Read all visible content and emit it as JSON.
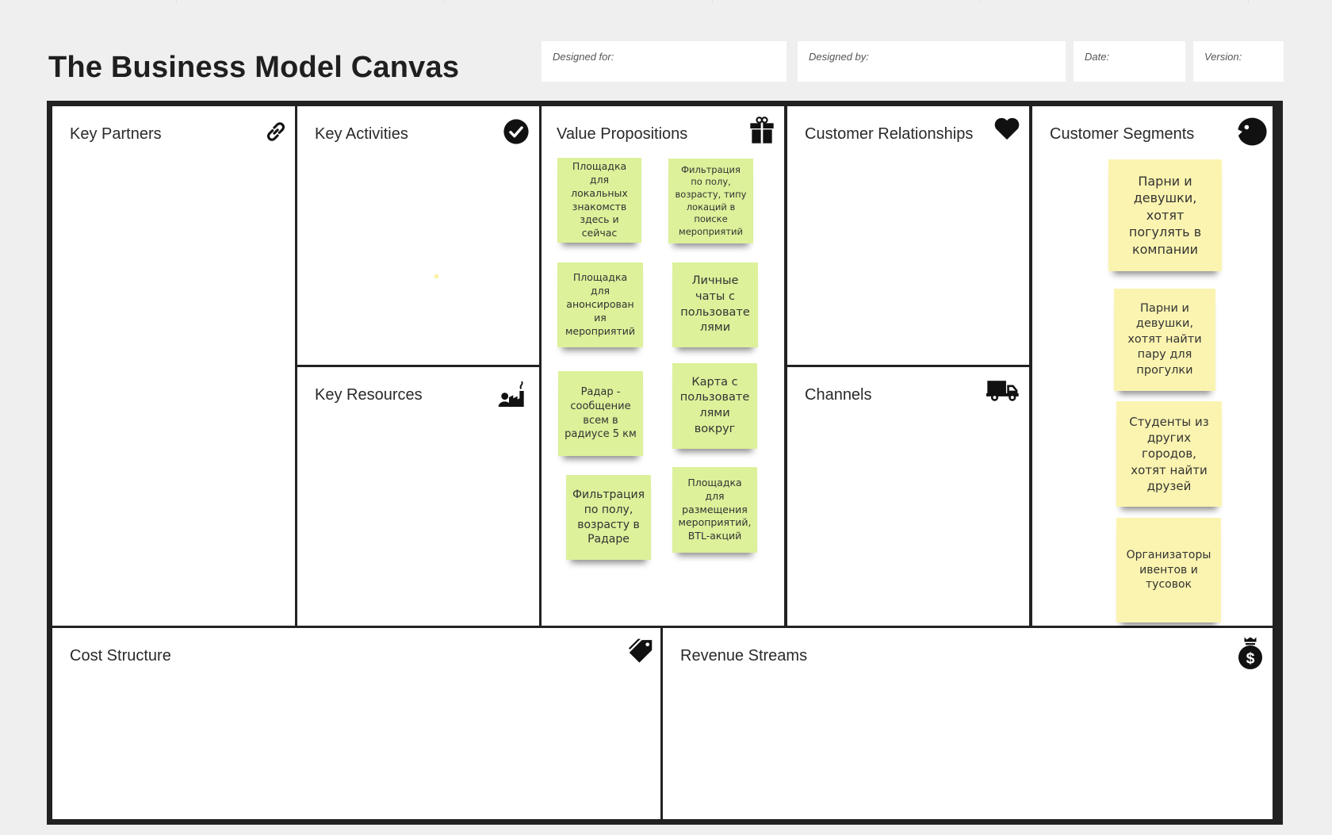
{
  "header": {
    "title": "The Business Model Canvas",
    "fields": [
      {
        "label": "Designed for:",
        "value": ""
      },
      {
        "label": "Designed by:",
        "value": ""
      },
      {
        "label": "Date:",
        "value": ""
      },
      {
        "label": "Version:",
        "value": ""
      }
    ]
  },
  "blocks": {
    "key_partners": {
      "title": "Key Partners",
      "icon": "link-icon"
    },
    "key_activities": {
      "title": "Key Activities",
      "icon": "check-circle-icon"
    },
    "key_resources": {
      "title": "Key Resources",
      "icon": "factory-person-icon"
    },
    "value_propositions": {
      "title": "Value Propositions",
      "icon": "gift-icon",
      "notes": [
        "Площадка для локальных знакомств здесь и сейчас",
        "Фильтрация по полу, возрасту, типу локаций в поиске мероприятий",
        "Площадка для анонсирован ия мероприятий",
        "Личные чаты с пользовате лями",
        "Радар - сообщение всем в радиусе 5 км",
        "Карта с пользовате лями вокруг",
        "Фильтрация по полу, возрасту в Радаре",
        "Площадка для размещения мероприятий, BTL-акций"
      ]
    },
    "customer_relationships": {
      "title": "Customer Relationships",
      "icon": "heart-icon"
    },
    "channels": {
      "title": "Channels",
      "icon": "truck-icon"
    },
    "customer_segments": {
      "title": "Customer Segments",
      "icon": "face-icon",
      "notes": [
        "Парни и девушки, хотят погулять в компании",
        "Парни и девушки, хотят найти пару для прогулки",
        "Студенты из других городов, хотят найти друзей",
        "Организаторы ивентов и тусовок"
      ]
    },
    "cost_structure": {
      "title": "Cost Structure",
      "icon": "price-tag-icon"
    },
    "revenue_streams": {
      "title": "Revenue Streams",
      "icon": "money-bag-icon"
    }
  },
  "colors": {
    "value_note": "#dcf19a",
    "segment_note": "#fbf4b0",
    "frame": "#222222",
    "background": "#efefef"
  }
}
